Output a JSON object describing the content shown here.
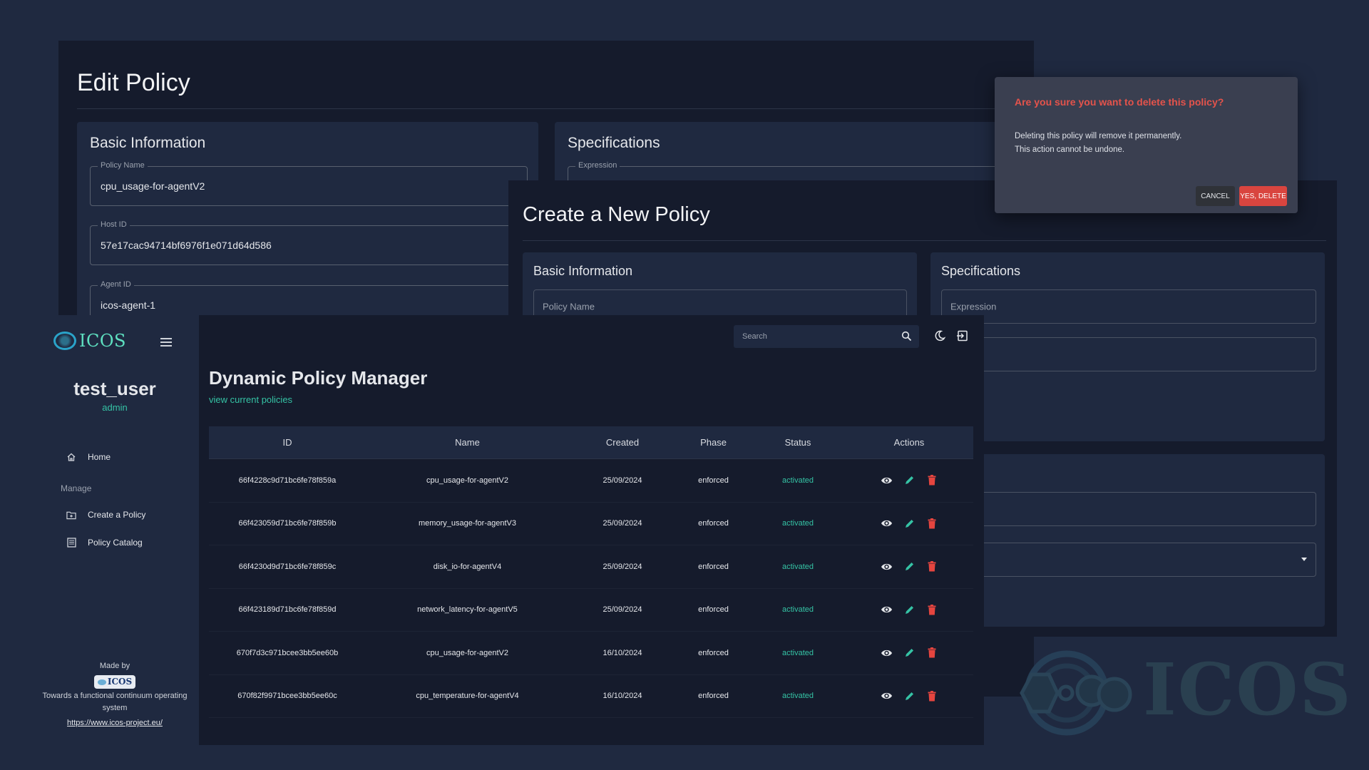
{
  "edit_policy": {
    "title": "Edit Policy",
    "basic_info": {
      "heading": "Basic Information",
      "fields": [
        {
          "label": "Policy Name",
          "value": "cpu_usage-for-agentV2"
        },
        {
          "label": "Host ID",
          "value": "57e17cac94714bf6976f1e071d64d586"
        },
        {
          "label": "Agent ID",
          "value": "icos-agent-1"
        }
      ]
    },
    "specifications": {
      "heading": "Specifications",
      "expression_label": "Expression"
    }
  },
  "create_policy": {
    "title": "Create a New Policy",
    "basic_info": {
      "heading": "Basic Information",
      "policy_name_placeholder": "Policy Name"
    },
    "specifications": {
      "heading": "Specifications",
      "expression_placeholder": "Expression"
    }
  },
  "delete_dialog": {
    "title": "Are you sure you want to delete this policy?",
    "body_line1": "Deleting this policy will remove it permanently.",
    "body_line2": "This action cannot be undone.",
    "cancel_label": "CANCEL",
    "confirm_label": "YES, DELETE"
  },
  "sidebar": {
    "brand": "ICOS",
    "user_name": "test_user",
    "user_role": "admin",
    "items": [
      {
        "label": "Home",
        "icon": "home-icon"
      },
      {
        "label": "Create a Policy",
        "icon": "folder-plus-icon"
      },
      {
        "label": "Policy Catalog",
        "icon": "list-document-icon"
      }
    ],
    "section_label": "Manage",
    "footer": {
      "made_by": "Made by",
      "logo_text": "ICOS",
      "tagline": "Towards a functional continuum operating system",
      "link": "https://www.icos-project.eu/"
    }
  },
  "header": {
    "search_placeholder": "Search",
    "icons": [
      "search-icon",
      "dark-mode-moon-icon",
      "logout-icon"
    ]
  },
  "main": {
    "title": "Dynamic Policy Manager",
    "subtitle": "view current policies",
    "table": {
      "columns": [
        "ID",
        "Name",
        "Created",
        "Phase",
        "Status",
        "Actions"
      ],
      "rows": [
        {
          "id": "66f4228c9d71bc6fe78f859a",
          "name": "cpu_usage-for-agentV2",
          "created": "25/09/2024",
          "phase": "enforced",
          "status": "activated"
        },
        {
          "id": "66f423059d71bc6fe78f859b",
          "name": "memory_usage-for-agentV3",
          "created": "25/09/2024",
          "phase": "enforced",
          "status": "activated"
        },
        {
          "id": "66f4230d9d71bc6fe78f859c",
          "name": "disk_io-for-agentV4",
          "created": "25/09/2024",
          "phase": "enforced",
          "status": "activated"
        },
        {
          "id": "66f423189d71bc6fe78f859d",
          "name": "network_latency-for-agentV5",
          "created": "25/09/2024",
          "phase": "enforced",
          "status": "activated"
        },
        {
          "id": "670f7d3c971bcee3bb5ee60b",
          "name": "cpu_usage-for-agentV2",
          "created": "16/10/2024",
          "phase": "enforced",
          "status": "activated"
        },
        {
          "id": "670f82f9971bcee3bb5ee60c",
          "name": "cpu_temperature-for-agentV4",
          "created": "16/10/2024",
          "phase": "enforced",
          "status": "activated"
        }
      ],
      "actions": [
        "view-eye-icon",
        "edit-pencil-icon",
        "delete-trash-icon"
      ]
    }
  },
  "watermark": {
    "text": "ICOS"
  },
  "colors": {
    "accent": "#35c3a5",
    "danger": "#e5534b",
    "background": "#1f2940",
    "panel": "#151b2c"
  }
}
